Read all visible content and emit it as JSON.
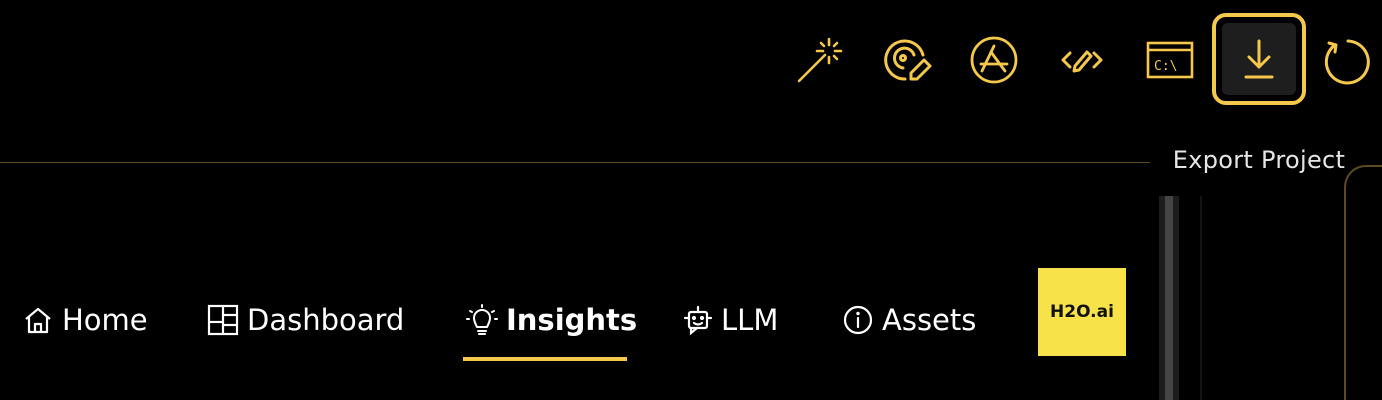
{
  "toolbar": {
    "accent_color": "#f5c84c",
    "buttons": [
      {
        "icon": "magic-wand-icon"
      },
      {
        "icon": "target-edit-icon"
      },
      {
        "icon": "app-store-icon"
      },
      {
        "icon": "code-edit-icon"
      },
      {
        "icon": "terminal-icon",
        "glyph": "C:\\"
      },
      {
        "icon": "download-icon",
        "active": true
      },
      {
        "icon": "refresh-icon"
      }
    ],
    "tooltip": "Export Project"
  },
  "nav": {
    "items": [
      {
        "label": "Home",
        "icon": "home-icon"
      },
      {
        "label": "Dashboard",
        "icon": "dashboard-icon"
      },
      {
        "label": "Insights",
        "icon": "lightbulb-icon",
        "active": true
      },
      {
        "label": "LLM",
        "icon": "robot-icon"
      },
      {
        "label": "Assets",
        "icon": "info-icon"
      }
    ],
    "logo_text": "H2O.ai",
    "logo_color": "#f7e24a"
  }
}
